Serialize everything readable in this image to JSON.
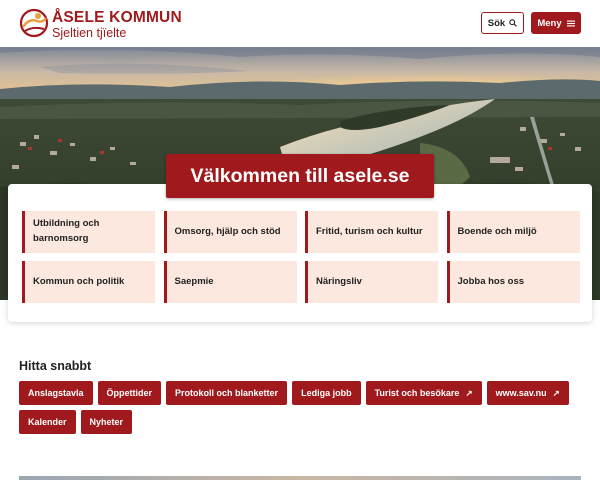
{
  "header": {
    "brand_name": "ÅSELE KOMMUN",
    "brand_sub": "Sjeltien tjïelte",
    "search_label": "Sök",
    "menu_label": "Meny"
  },
  "hero": {
    "welcome": "Välkommen till asele.se"
  },
  "categories": [
    {
      "label": "Utbildning och barnomsorg"
    },
    {
      "label": "Omsorg, hjälp och stöd"
    },
    {
      "label": "Fritid, turism och kultur"
    },
    {
      "label": "Boende och miljö"
    },
    {
      "label": "Kommun och politik"
    },
    {
      "label": "Saepmie"
    },
    {
      "label": "Näringsliv"
    },
    {
      "label": "Jobba hos oss"
    }
  ],
  "quick": {
    "title": "Hitta snabbt",
    "links": [
      {
        "label": "Anslagstavla",
        "external": false
      },
      {
        "label": "Öppettider",
        "external": false
      },
      {
        "label": "Protokoll och blanketter",
        "external": false
      },
      {
        "label": "Lediga jobb",
        "external": false
      },
      {
        "label": "Turist och besökare",
        "external": true
      },
      {
        "label": "www.sav.nu",
        "external": true
      },
      {
        "label": "Kalender",
        "external": false
      },
      {
        "label": "Nyheter",
        "external": false
      }
    ]
  },
  "icons": {
    "search": "search-icon",
    "menu": "hamburger-icon",
    "external": "external-link-icon",
    "logo": "asele-logo-icon"
  },
  "colors": {
    "brand": "#a01a1d",
    "tile_bg": "#fde8df"
  }
}
